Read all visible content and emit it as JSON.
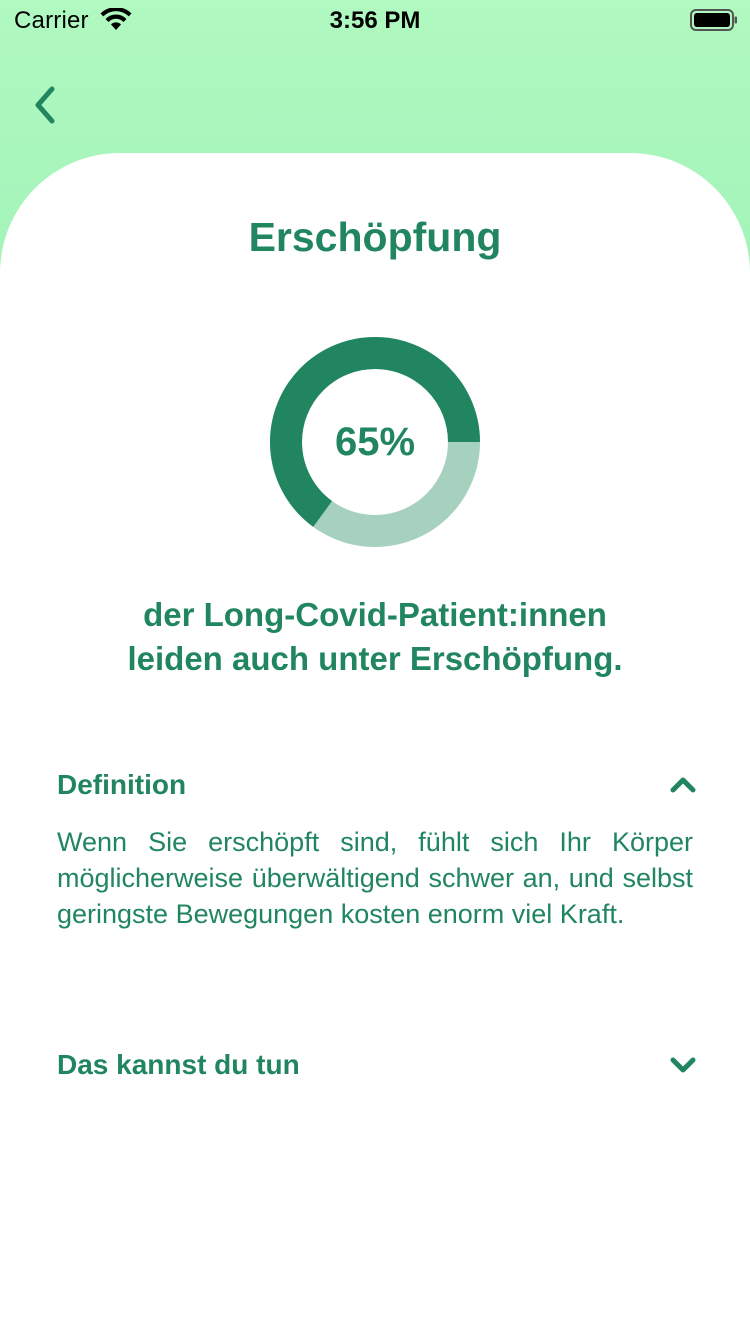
{
  "status_bar": {
    "carrier": "Carrier",
    "time": "3:56 PM"
  },
  "colors": {
    "header_bg": "#aaf6bc",
    "primary_green": "#218660",
    "light_green": "#a6d1be"
  },
  "header": {
    "back_icon": "chevron-left-icon"
  },
  "page": {
    "title": "Erschöpfung",
    "stat": {
      "percent_value": 65,
      "percent_label": "65%"
    },
    "subtitle_line1": "der Long-Covid-Patient:innen",
    "subtitle_line2": "leiden auch unter Erschöpfung."
  },
  "sections": [
    {
      "title": "Definition",
      "expanded": true,
      "icon": "chevron-up-icon",
      "body": "Wenn Sie erschöpft sind, fühlt sich Ihr Körper möglicherweise überwältigend schwer an, und selbst geringste Bewegungen kosten enorm viel Kraft."
    },
    {
      "title": "Das kannst du tun",
      "expanded": false,
      "icon": "chevron-down-icon"
    }
  ]
}
